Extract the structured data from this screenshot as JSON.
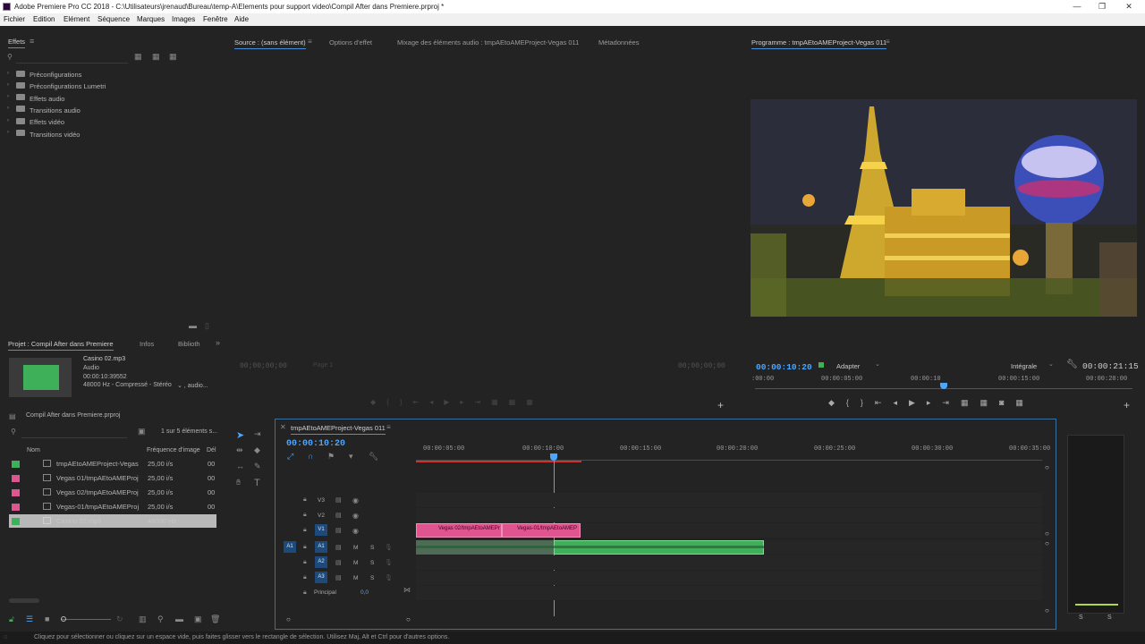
{
  "window": {
    "title": "Adobe Premiere Pro CC 2018 - C:\\Utilisateurs\\jrenaud\\Bureau\\temp-A\\Elements pour support video\\Compil After dans Premiere.prproj *",
    "minimize": "—",
    "restore": "❐",
    "close": "✕"
  },
  "menu": [
    "Fichier",
    "Edition",
    "Elément",
    "Séquence",
    "Marques",
    "Images",
    "Fenêtre",
    "Aide"
  ],
  "effects_panel": {
    "title": "Effets",
    "items": [
      "Préconfigurations",
      "Préconfigurations Lumetri",
      "Effets audio",
      "Transitions audio",
      "Effets vidéo",
      "Transitions vidéo"
    ]
  },
  "source_panel": {
    "tabs": [
      "Source : (sans élément)",
      "Options d'effet",
      "Mixage des éléments audio : tmpAEtoAMEProject-Vegas 011",
      "Métadonnées"
    ],
    "timecode_left": "00;00;00;00",
    "page": "Page 1",
    "timecode_right": "00;00;00;00"
  },
  "program_panel": {
    "title": "Programme : tmpAEtoAMEProject-Vegas 011",
    "timecode": "00:00:10:20",
    "fit": "Adapter",
    "quality": "Intégrale",
    "duration": "00:00:21:15",
    "ruler": [
      ":00:00",
      "00:00:05:00",
      "00:00:10",
      "00:00:15:00",
      "00:00:20:00"
    ],
    "playhead_fraction": 0.5
  },
  "project_panel": {
    "tabs": [
      "Projet : Compil After dans Premiere",
      "Infos",
      "Biblioth"
    ],
    "preview": {
      "name": "Casino 02.mp3",
      "type": "Audio",
      "duration": "00:00:10:39552",
      "format": "48000 Hz - Compressé - Stéréo",
      "extra": "⌄ , audio..."
    },
    "bin": "Compil After dans Premiere.prproj",
    "count": "1 sur 5 éléments s...",
    "columns": [
      "Nom",
      "Fréquence d'image",
      "Dél"
    ],
    "rows": [
      {
        "name": "tmpAEtoAMEProject-Vegas",
        "fps": "25,00 i/s",
        "del": "00",
        "color": "#3fb05a"
      },
      {
        "name": "Vegas 01/tmpAEtoAMEProj",
        "fps": "25,00 i/s",
        "del": "00",
        "color": "#e0548f"
      },
      {
        "name": "Vegas 02/tmpAEtoAMEProj",
        "fps": "25,00 i/s",
        "del": "00",
        "color": "#e0548f"
      },
      {
        "name": "Vegas-01/tmpAEtoAMEProj",
        "fps": "25,00 i/s",
        "del": "00",
        "color": "#e0548f"
      },
      {
        "name": "Casino 02.mp3",
        "fps": "48000 Hz",
        "del": "",
        "color": "#3fb05a"
      }
    ]
  },
  "timeline": {
    "tab": "tmpAEtoAMEProject-Vegas 011",
    "timecode": "00:00:10:20",
    "ruler": [
      "00:00:05:00",
      "00:00:10:00",
      "00:00:15:00",
      "00:00:20:00",
      "00:00:25:00",
      "00:00:30:00",
      "00:00:35:00"
    ],
    "tracks": {
      "video": [
        "V3",
        "V2",
        "V1"
      ],
      "audio": [
        "A1",
        "A2",
        "A3"
      ],
      "master": "Principal",
      "master_value": "0,0",
      "source_patch": "A1"
    },
    "clips": [
      {
        "label": "Vegas 02/tmpAEtoAMEPr",
        "kind": "video"
      },
      {
        "label": "Vegas-01/tmpAEtoAMEP",
        "kind": "video"
      }
    ],
    "m": "M",
    "s": "S"
  },
  "meter": {
    "labels": [
      "S",
      "S"
    ]
  },
  "status": "Cliquez pour sélectionner ou cliquez sur un espace vide, puis faites glisser vers le rectangle de sélection. Utilisez Maj, Alt et Ctrl pour d'autres options.",
  "colors": {
    "accent": "#4aa6ff",
    "video_clip": "#e0548f",
    "audio_clip": "#3fb05a"
  }
}
